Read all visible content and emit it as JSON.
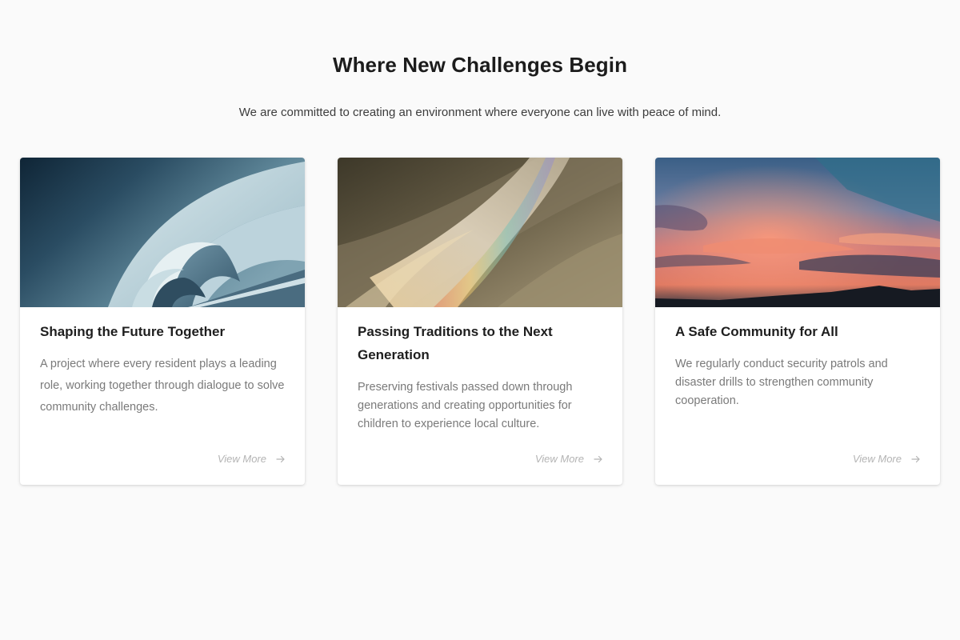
{
  "section": {
    "title": "Where New Challenges Begin",
    "subtitle": "We are committed to creating an environment where everyone can live with peace of mind."
  },
  "cards": [
    {
      "image": "architecture-spiral-photo",
      "title": "Shaping the Future Together",
      "description": "A project where every resident plays a leading role, working together through dialogue to solve community challenges.",
      "link_label": "View More",
      "link_icon": "arrow-right-icon"
    },
    {
      "image": "prism-light-photo",
      "title": "Passing Traditions to the Next Generation",
      "description": "Preserving festivals passed down through generations and creating opportunities for children to experience local culture.",
      "link_label": "View More",
      "link_icon": "arrow-right-icon"
    },
    {
      "image": "sunset-sky-photo",
      "title": "A Safe Community for All",
      "description": "We regularly conduct security patrols and disaster drills to strengthen community cooperation.",
      "link_label": "View More",
      "link_icon": "arrow-right-icon"
    }
  ],
  "colors": {
    "background": "#fafafa",
    "card": "#ffffff",
    "title": "#1c1c1c",
    "description": "#7a7a7a",
    "link": "#b4b4b4"
  }
}
